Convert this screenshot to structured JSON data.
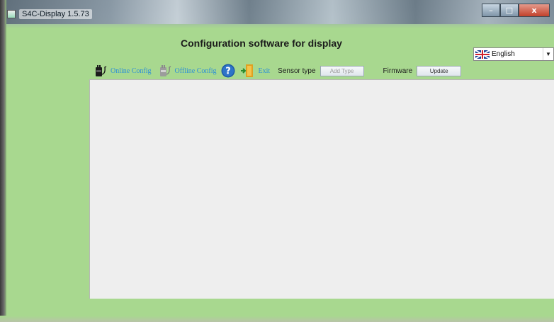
{
  "window": {
    "title": "S4C-Display 1.5.73",
    "controls": {
      "minimize": "–",
      "maximize": "□",
      "close": "x"
    }
  },
  "heading": "Configuration software for display",
  "language": {
    "selected": "English",
    "flag_icon": "uk-flag-icon",
    "arrow": "▼"
  },
  "toolbar": {
    "online_config": "Online Config",
    "offline_config": "Offline Config",
    "help_symbol": "?",
    "exit": "Exit",
    "sensor_type_label": "Sensor type",
    "add_type_button": "Add Type",
    "firmware_label": "Firmware",
    "update_button": "Update"
  },
  "colors": {
    "background": "#a8d88f",
    "panel": "#eeeeee",
    "link": "#2d8fd6"
  }
}
